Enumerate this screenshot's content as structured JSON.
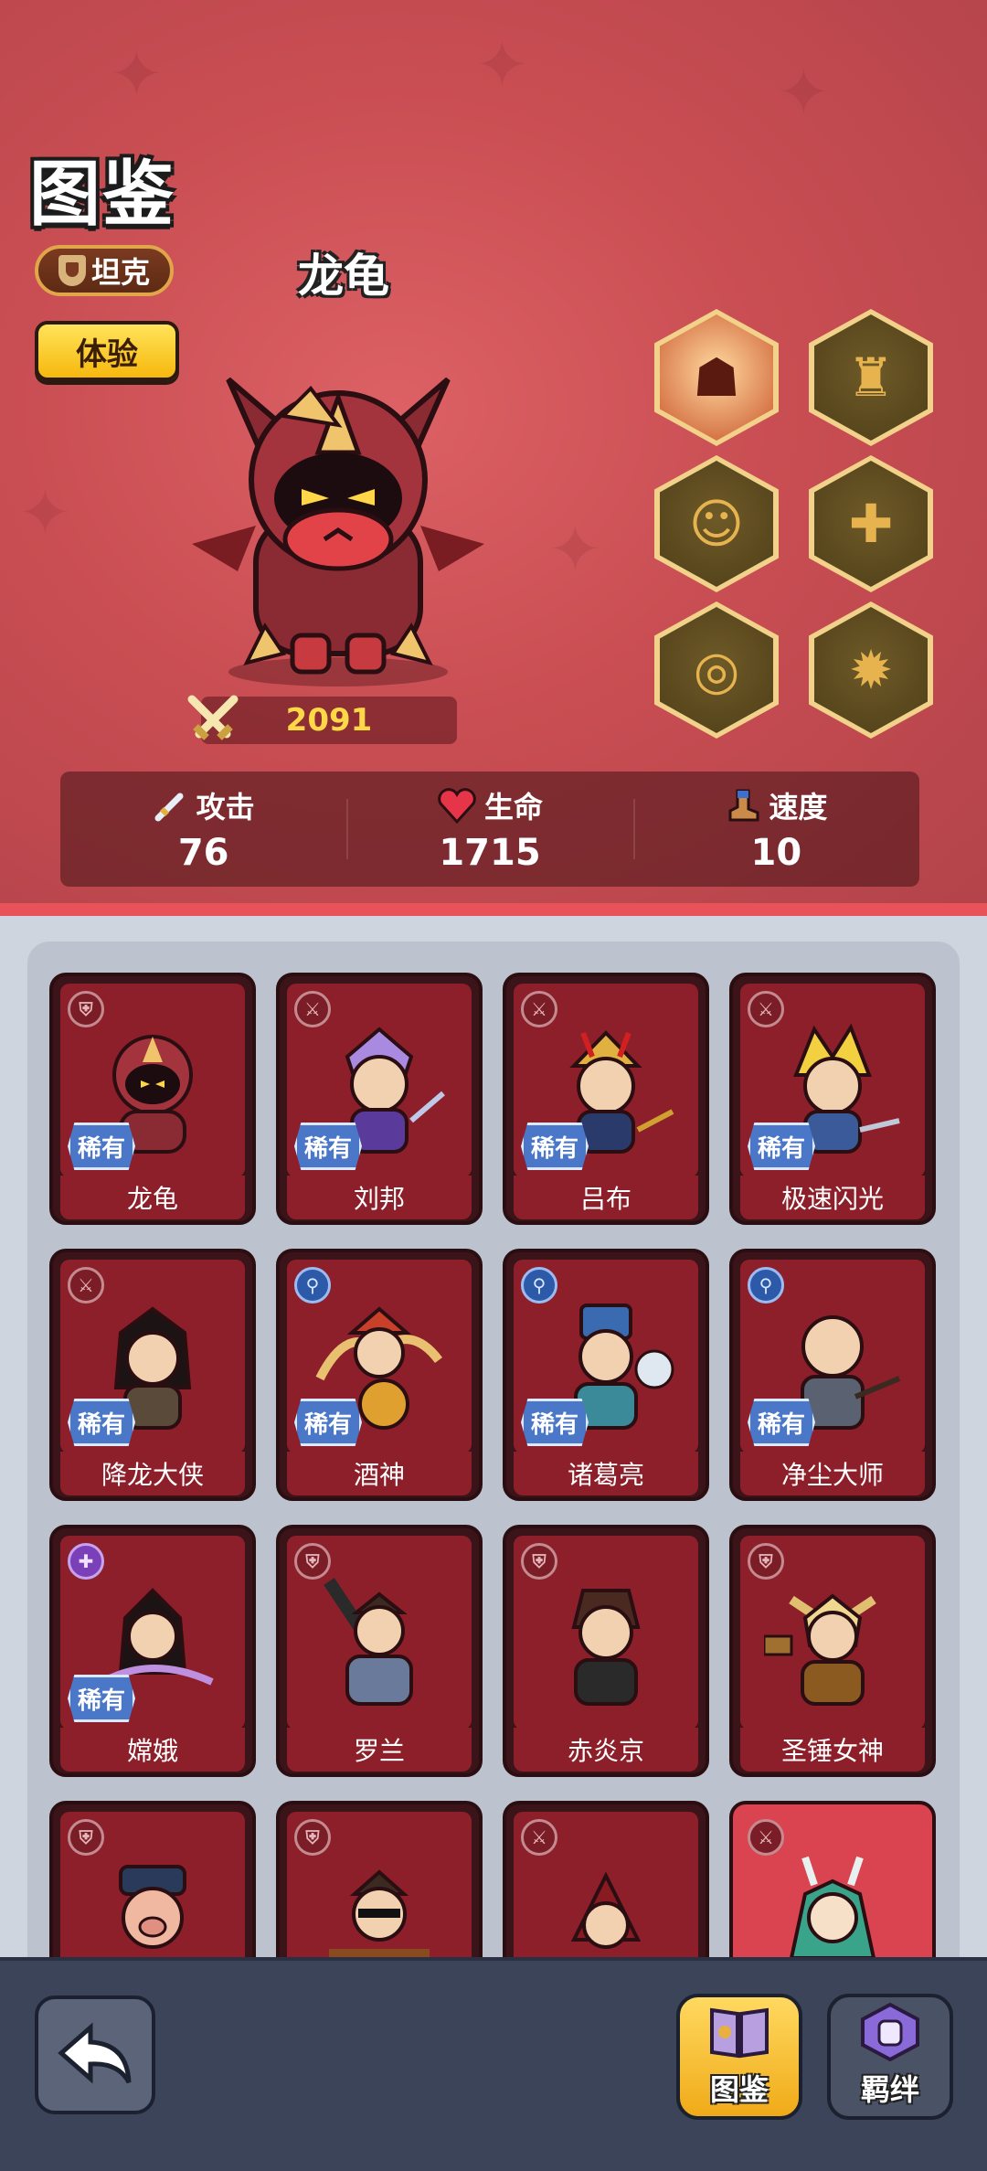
{
  "page": {
    "title": "图鉴",
    "role_label": "坦克",
    "trial_label": "体验",
    "hero_name": "龙龟",
    "power": "2091"
  },
  "skills": [
    {
      "icon": "demon-skill-icon",
      "active": true
    },
    {
      "icon": "armor-skill-icon",
      "active": false
    },
    {
      "icon": "whirl-skill-icon",
      "active": false
    },
    {
      "icon": "buff-skill-icon",
      "active": false
    },
    {
      "icon": "swirl-skill-icon",
      "active": false
    },
    {
      "icon": "burst-skill-icon",
      "active": false
    }
  ],
  "stats": [
    {
      "label": "攻击",
      "value": "76",
      "icon": "sword-icon"
    },
    {
      "label": "生命",
      "value": "1715",
      "icon": "heart-icon"
    },
    {
      "label": "速度",
      "value": "10",
      "icon": "boot-icon"
    }
  ],
  "heroes": [
    {
      "name": "龙龟",
      "rarity": "稀有",
      "role": "shield",
      "style": "normal"
    },
    {
      "name": "刘邦",
      "rarity": "稀有",
      "role": "sword",
      "style": "normal"
    },
    {
      "name": "吕布",
      "rarity": "稀有",
      "role": "sword",
      "style": "normal"
    },
    {
      "name": "极速闪光",
      "rarity": "稀有",
      "role": "sword",
      "style": "normal"
    },
    {
      "name": "降龙大侠",
      "rarity": "稀有",
      "role": "sword",
      "style": "normal"
    },
    {
      "name": "酒神",
      "rarity": "稀有",
      "role": "magic",
      "style": "normal"
    },
    {
      "name": "诸葛亮",
      "rarity": "稀有",
      "role": "magic",
      "style": "normal"
    },
    {
      "name": "净尘大师",
      "rarity": "稀有",
      "role": "magic",
      "style": "normal"
    },
    {
      "name": "嫦娥",
      "rarity": "稀有",
      "role": "heal",
      "style": "normal"
    },
    {
      "name": "罗兰",
      "rarity": "",
      "role": "shield",
      "style": "normal"
    },
    {
      "name": "赤炎京",
      "rarity": "",
      "role": "shield",
      "style": "normal"
    },
    {
      "name": "圣锤女神",
      "rarity": "",
      "role": "shield",
      "style": "normal"
    },
    {
      "name": "",
      "rarity": "",
      "role": "shield",
      "style": "normal"
    },
    {
      "name": "",
      "rarity": "",
      "role": "shield",
      "style": "normal"
    },
    {
      "name": "",
      "rarity": "",
      "role": "sword",
      "style": "normal"
    },
    {
      "name": "",
      "rarity": "",
      "role": "sword",
      "style": "red"
    }
  ],
  "nav": {
    "back_icon": "back-arrow-icon",
    "codex_label": "图鉴",
    "bond_label": "羁绊"
  },
  "colors": {
    "top_bg": "#c94b50",
    "card_bg": "#8c1f2a",
    "gold": "#ffd848",
    "nav_bg": "#3b4458"
  }
}
